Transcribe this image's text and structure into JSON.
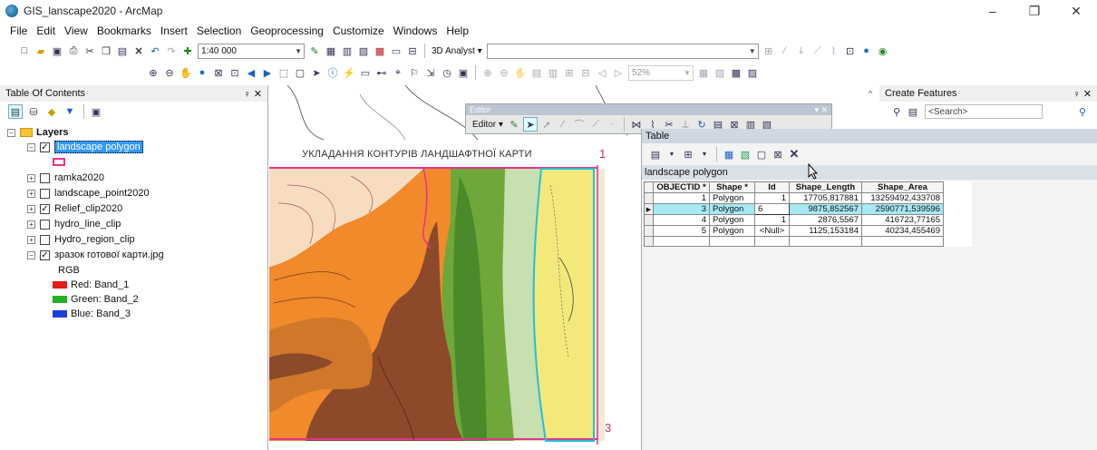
{
  "window": {
    "title": "GIS_lanscape2020 - ArcMap",
    "controls": [
      "–",
      "❐",
      "✕"
    ]
  },
  "menu": [
    "File",
    "Edit",
    "View",
    "Bookmarks",
    "Insert",
    "Selection",
    "Geoprocessing",
    "Customize",
    "Windows",
    "Help"
  ],
  "toolbar": {
    "scale": "1:40 000",
    "analyst_label": "3D Analyst ▾",
    "zoom_value": "52%"
  },
  "toc": {
    "title": "Table Of Contents",
    "pin": "♀ ✕",
    "root": "Layers",
    "layers": [
      {
        "name": "landscape polygon",
        "checked": true,
        "selected": true
      },
      {
        "name": "ramka2020",
        "checked": false
      },
      {
        "name": "landscape_point2020",
        "checked": false
      },
      {
        "name": "Relief_clip2020",
        "checked": true
      },
      {
        "name": "hydro_line_clip",
        "checked": false
      },
      {
        "name": "Hydro_region_clip",
        "checked": false
      },
      {
        "name": "зразок готової карти.jpg",
        "checked": true
      }
    ],
    "rgb_label": "RGB",
    "bands": [
      {
        "label": "Red:  Band_1",
        "color": "#e21b1b"
      },
      {
        "label": "Green: Band_2",
        "color": "#22b022"
      },
      {
        "label": "Blue:  Band_3",
        "color": "#1b3fd9"
      }
    ]
  },
  "map": {
    "title": "УКЛАДАННЯ КОНТУРІВ ЛАНДШАФТНОЇ КАРТИ",
    "corner_top": "1",
    "corner_bottom": "3",
    "pink": "#e0358a",
    "cyan": "#22c0d8"
  },
  "editor": {
    "title": "Editor",
    "menu": "Editor ▾"
  },
  "table": {
    "title": "Table",
    "layer_tab": "landscape polygon",
    "columns": [
      "OBJECTID *",
      "Shape *",
      "Id",
      "Shape_Length",
      "Shape_Area"
    ],
    "rows": [
      {
        "objectid": "1",
        "shape": "Polygon",
        "id": "1",
        "length": "17705,817881",
        "area": "13259492,433708",
        "highlight": false
      },
      {
        "objectid": "3",
        "shape": "Polygon",
        "id": "6",
        "length": "9875,852567",
        "area": "2590771,539596",
        "highlight": true
      },
      {
        "objectid": "4",
        "shape": "Polygon",
        "id": "1",
        "length": "2876,5567",
        "area": "416723,77165",
        "highlight": false
      },
      {
        "objectid": "5",
        "shape": "Polygon",
        "id": "<Null>",
        "length": "1125,153184",
        "area": "40234,455469",
        "highlight": false
      }
    ]
  },
  "create_features": {
    "title": "Create Features",
    "pin": "♀ ✕",
    "search_placeholder": "<Search>"
  }
}
